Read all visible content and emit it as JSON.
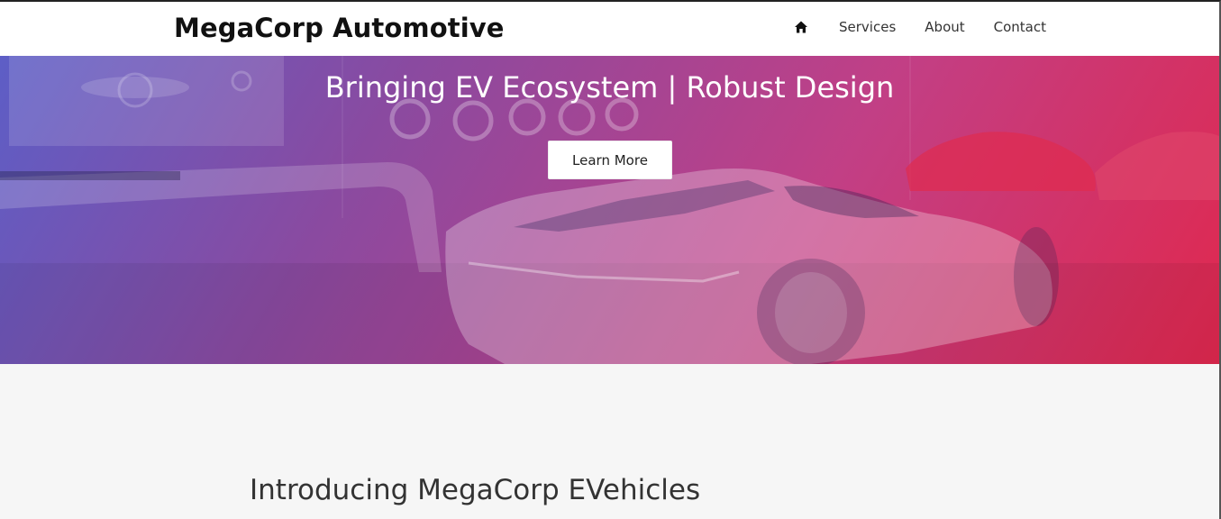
{
  "brand": "MegaCorp Automotive",
  "nav": {
    "home_icon": "home-icon",
    "items": [
      "Services",
      "About",
      "Contact"
    ]
  },
  "hero": {
    "title": "Bringing EV Ecosystem | Robust Design",
    "button_label": "Learn More",
    "gradient": [
      "#5d5ec6",
      "#c23f85",
      "#e0284e"
    ]
  },
  "section": {
    "title": "Introducing MegaCorp EVehicles"
  }
}
